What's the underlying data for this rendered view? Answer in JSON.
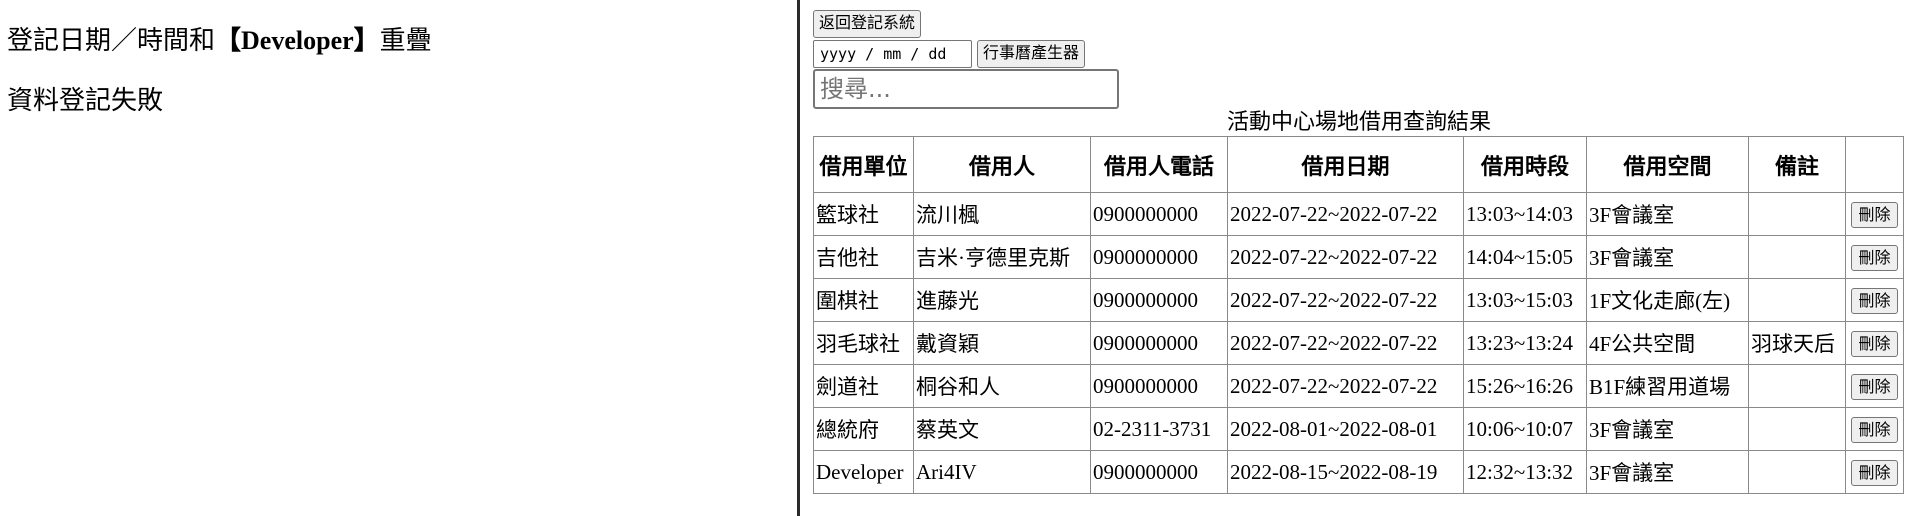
{
  "messages": {
    "overlap_prefix": "登記日期／時間和",
    "overlap_bracket_left": "【",
    "overlap_unit": "Developer",
    "overlap_bracket_right": "】",
    "overlap_suffix": "重疊",
    "failure": "資料登記失敗"
  },
  "toolbar": {
    "back_label": "返回登記系統",
    "date_value": "yyyy / mm / dd",
    "calendar_label": "行事曆產生器",
    "search_placeholder": "搜尋..."
  },
  "table": {
    "caption": "活動中心場地借用查詢結果",
    "headers": [
      "借用單位",
      "借用人",
      "借用人電話",
      "借用日期",
      "借用時段",
      "借用空間",
      "備註",
      ""
    ],
    "delete_label": "刪除",
    "rows": [
      {
        "unit": "籃球社",
        "person": "流川楓",
        "phone": "0900000000",
        "date": "2022-07-22~2022-07-22",
        "time": "13:03~14:03",
        "space": "3F會議室",
        "note": ""
      },
      {
        "unit": "吉他社",
        "person": "吉米·亨德里克斯",
        "phone": "0900000000",
        "date": "2022-07-22~2022-07-22",
        "time": "14:04~15:05",
        "space": "3F會議室",
        "note": ""
      },
      {
        "unit": "圍棋社",
        "person": "進藤光",
        "phone": "0900000000",
        "date": "2022-07-22~2022-07-22",
        "time": "13:03~15:03",
        "space": "1F文化走廊(左)",
        "note": ""
      },
      {
        "unit": "羽毛球社",
        "person": "戴資穎",
        "phone": "0900000000",
        "date": "2022-07-22~2022-07-22",
        "time": "13:23~13:24",
        "space": "4F公共空間",
        "note": "羽球天后"
      },
      {
        "unit": "劍道社",
        "person": "桐谷和人",
        "phone": "0900000000",
        "date": "2022-07-22~2022-07-22",
        "time": "15:26~16:26",
        "space": "B1F練習用道場",
        "note": ""
      },
      {
        "unit": "總統府",
        "person": "蔡英文",
        "phone": "02-2311-3731",
        "date": "2022-08-01~2022-08-01",
        "time": "10:06~10:07",
        "space": "3F會議室",
        "note": ""
      },
      {
        "unit": "Developer",
        "person": "Ari4IV",
        "phone": "0900000000",
        "date": "2022-08-15~2022-08-19",
        "time": "12:32~13:32",
        "space": "3F會議室",
        "note": ""
      }
    ]
  }
}
